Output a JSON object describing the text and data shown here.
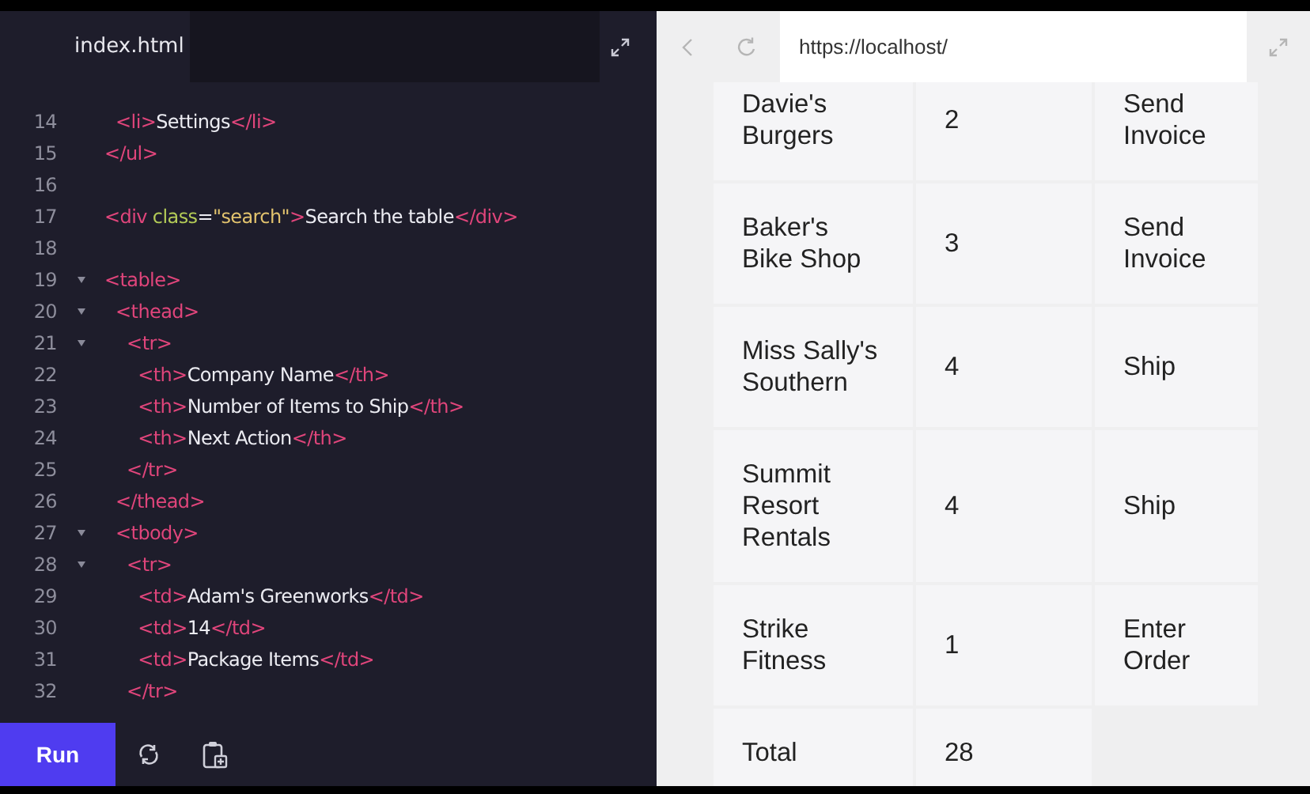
{
  "editor": {
    "tab": "index.html",
    "lines": [
      {
        "number": "14",
        "foldable": false,
        "tokens": [
          {
            "kind": "tag",
            "text": "  <li>"
          },
          {
            "kind": "text",
            "text": "Settings"
          },
          {
            "kind": "tag",
            "text": "</li>"
          }
        ]
      },
      {
        "number": "15",
        "foldable": false,
        "tokens": [
          {
            "kind": "tag",
            "text": "</ul>"
          }
        ]
      },
      {
        "number": "16",
        "foldable": false
      },
      {
        "number": "17",
        "foldable": false,
        "tokens": [
          {
            "kind": "tag",
            "text": "<div"
          },
          {
            "kind": "attr",
            "text": " class"
          },
          {
            "kind": "text",
            "text": "="
          },
          {
            "kind": "string",
            "text": "\"search\""
          },
          {
            "kind": "tag",
            "text": ">"
          },
          {
            "kind": "text",
            "text": "Search the table"
          },
          {
            "kind": "tag",
            "text": "</div>"
          }
        ]
      },
      {
        "number": "18",
        "foldable": false
      },
      {
        "number": "19",
        "foldable": true,
        "tokens": [
          {
            "kind": "tag",
            "text": "<table>"
          }
        ]
      },
      {
        "number": "20",
        "foldable": true,
        "tokens": [
          {
            "kind": "tag",
            "text": "  <thead>"
          }
        ]
      },
      {
        "number": "21",
        "foldable": true,
        "tokens": [
          {
            "kind": "tag",
            "text": "    <tr>"
          }
        ]
      },
      {
        "number": "22",
        "foldable": false,
        "tokens": [
          {
            "kind": "tag",
            "text": "      <th>"
          },
          {
            "kind": "text",
            "text": "Company Name"
          },
          {
            "kind": "tag",
            "text": "</th>"
          }
        ]
      },
      {
        "number": "23",
        "foldable": false,
        "tokens": [
          {
            "kind": "tag",
            "text": "      <th>"
          },
          {
            "kind": "text",
            "text": "Number of Items to Ship"
          },
          {
            "kind": "tag",
            "text": "</th>"
          }
        ]
      },
      {
        "number": "24",
        "foldable": false,
        "tokens": [
          {
            "kind": "tag",
            "text": "      <th>"
          },
          {
            "kind": "text",
            "text": "Next Action"
          },
          {
            "kind": "tag",
            "text": "</th>"
          }
        ]
      },
      {
        "number": "25",
        "foldable": false,
        "tokens": [
          {
            "kind": "tag",
            "text": "    </tr>"
          }
        ]
      },
      {
        "number": "26",
        "foldable": false,
        "tokens": [
          {
            "kind": "tag",
            "text": "  </thead>"
          }
        ]
      },
      {
        "number": "27",
        "foldable": true,
        "tokens": [
          {
            "kind": "tag",
            "text": "  <tbody>"
          }
        ]
      },
      {
        "number": "28",
        "foldable": true,
        "tokens": [
          {
            "kind": "tag",
            "text": "    <tr>"
          }
        ]
      },
      {
        "number": "29",
        "foldable": false,
        "tokens": [
          {
            "kind": "tag",
            "text": "      <td>"
          },
          {
            "kind": "text",
            "text": "Adam's Greenworks"
          },
          {
            "kind": "tag",
            "text": "</td>"
          }
        ]
      },
      {
        "number": "30",
        "foldable": false,
        "tokens": [
          {
            "kind": "tag",
            "text": "      <td>"
          },
          {
            "kind": "text",
            "text": "14"
          },
          {
            "kind": "tag",
            "text": "</td>"
          }
        ]
      },
      {
        "number": "31",
        "foldable": false,
        "tokens": [
          {
            "kind": "tag",
            "text": "      <td>"
          },
          {
            "kind": "text",
            "text": "Package Items"
          },
          {
            "kind": "tag",
            "text": "</td>"
          }
        ]
      },
      {
        "number": "32",
        "foldable": false,
        "tokens": [
          {
            "kind": "tag",
            "text": "    </tr>"
          }
        ]
      }
    ],
    "run_button": "Run"
  },
  "browser": {
    "url": "https://localhost/"
  },
  "table": {
    "rows": [
      {
        "cells": [
          "Davie's Burgers",
          "2",
          "Send Invoice"
        ]
      },
      {
        "cells": [
          "Baker's Bike Shop",
          "3",
          "Send Invoice"
        ]
      },
      {
        "cells": [
          "Miss Sally's Southern",
          "4",
          "Ship"
        ]
      },
      {
        "cells": [
          "Summit Resort Rentals",
          "4",
          "Ship"
        ]
      },
      {
        "cells": [
          "Strike Fitness",
          "1",
          "Enter Order"
        ]
      },
      {
        "cells": [
          "Total",
          "28"
        ]
      }
    ]
  }
}
